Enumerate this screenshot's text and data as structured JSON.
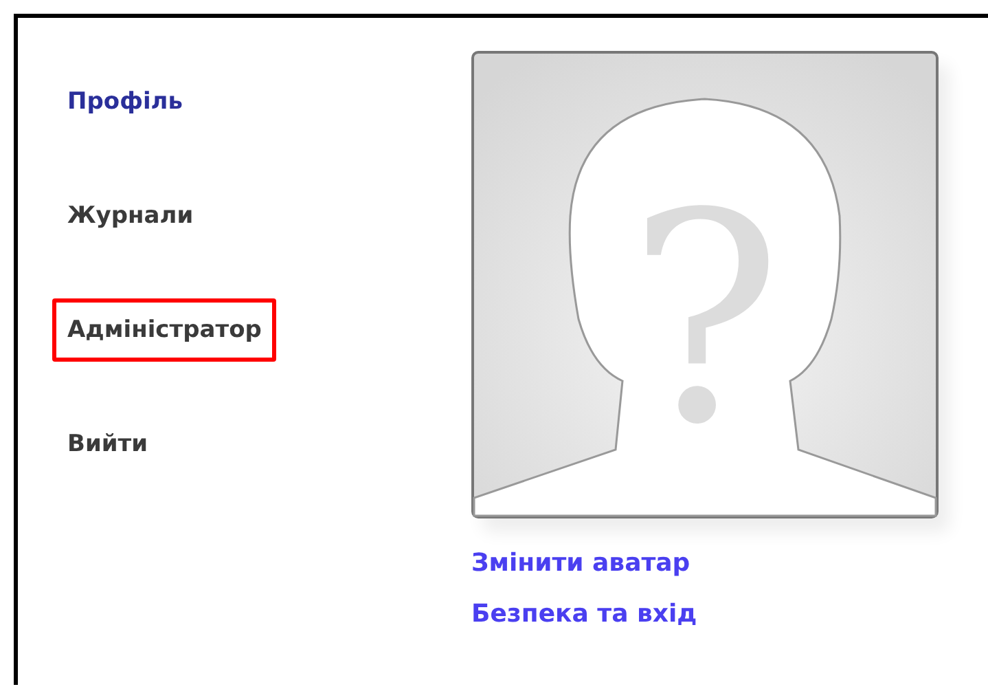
{
  "sidebar": {
    "items": [
      {
        "label": "Профіль",
        "selected": true,
        "highlighted": false
      },
      {
        "label": "Журнали",
        "selected": false,
        "highlighted": false
      },
      {
        "label": "Адміністратор",
        "selected": false,
        "highlighted": true
      },
      {
        "label": "Вийти",
        "selected": false,
        "highlighted": false
      }
    ]
  },
  "avatar": {
    "kind": "placeholder",
    "glyph": "?"
  },
  "links": [
    "Змінити аватар",
    "Безпека та вхід"
  ]
}
